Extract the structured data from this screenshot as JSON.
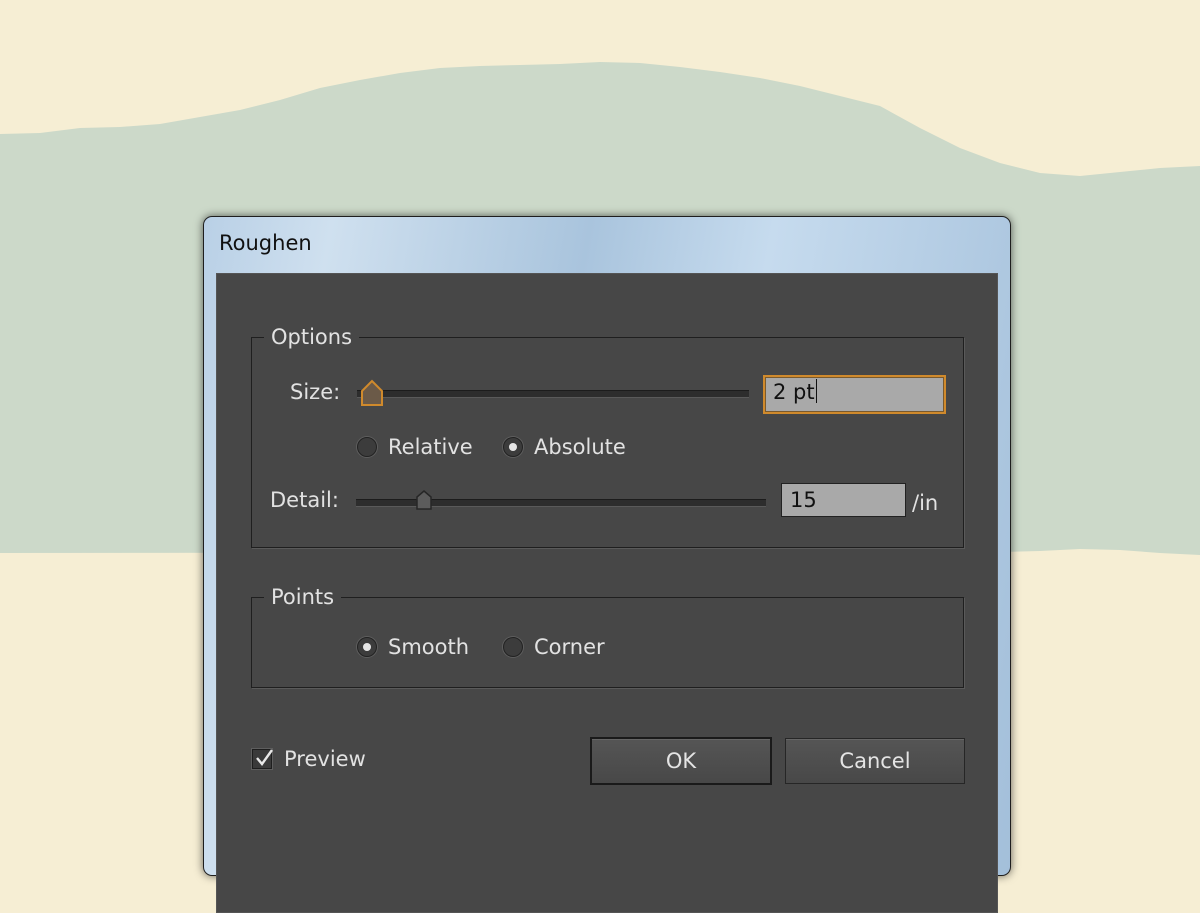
{
  "dialog": {
    "title": "Roughen",
    "options": {
      "legend": "Options",
      "size": {
        "label": "Size:",
        "value": "2 pt",
        "slider_fraction": 0.04
      },
      "mode": {
        "relative_label": "Relative",
        "absolute_label": "Absolute",
        "selected": "Absolute"
      },
      "detail": {
        "label": "Detail:",
        "value": "15",
        "unit": "/in",
        "slider_fraction": 0.15
      }
    },
    "points": {
      "legend": "Points",
      "smooth_label": "Smooth",
      "corner_label": "Corner",
      "selected": "Smooth"
    },
    "preview": {
      "label": "Preview",
      "checked": true
    },
    "buttons": {
      "ok": "OK",
      "cancel": "Cancel"
    }
  },
  "colors": {
    "background": "#f6eed4",
    "shape": "#ccd9c9",
    "dialog_body": "#474747",
    "focus_accent": "#d08a2c"
  }
}
